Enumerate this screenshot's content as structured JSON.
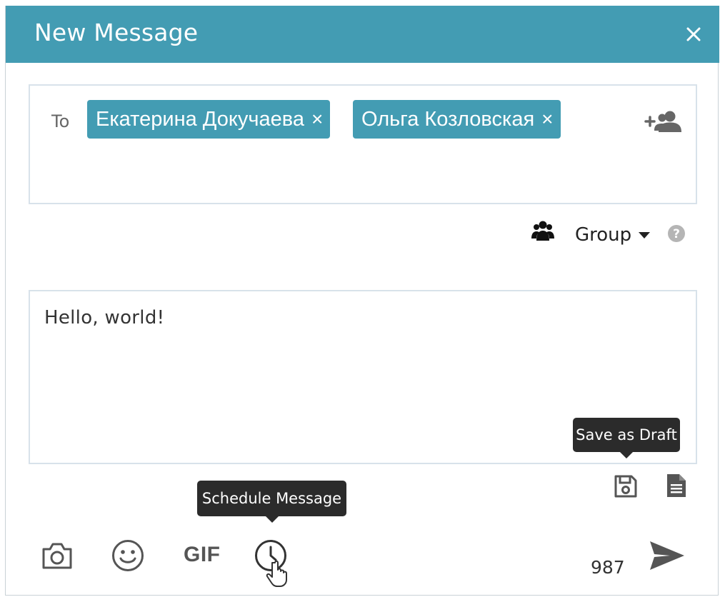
{
  "window": {
    "title": "New Message",
    "close_icon": "close-icon"
  },
  "recipients": {
    "label": "To",
    "chips": [
      {
        "name": "Екатерина Докучаева",
        "remove": "×"
      },
      {
        "name": "Ольга Козловская",
        "remove": "×"
      }
    ],
    "add_icon": "add-person-icon"
  },
  "group": {
    "icon": "group-icon",
    "selected": "Group",
    "help_icon": "question-circle-icon"
  },
  "message": {
    "text": "Hello, world!"
  },
  "tooltips": {
    "save_draft": "Save as Draft",
    "schedule": "Schedule Message"
  },
  "toolbar": {
    "icons": [
      "floppy-disk-icon",
      "document-icon",
      "camera-icon",
      "smiley-icon",
      "gif-icon",
      "clock-icon",
      "send-icon"
    ],
    "gif_label": "GIF",
    "char_count": "987"
  },
  "colors": {
    "accent": "#439cb3",
    "tooltip_bg": "#2b2b2b",
    "icon_gray": "#666666",
    "border": "#d8e2ea"
  }
}
